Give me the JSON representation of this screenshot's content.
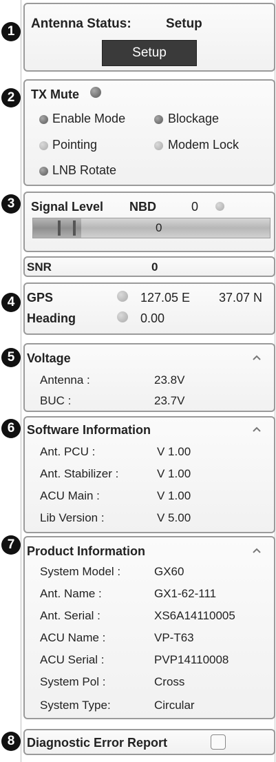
{
  "antenna_status": {
    "label": "Antenna Status:",
    "value": "Setup",
    "button_label": "Setup"
  },
  "tx_mute": {
    "title": "TX Mute",
    "indicators": [
      "Enable Mode",
      "Blockage",
      "Pointing",
      "Modem Lock",
      "LNB Rotate"
    ]
  },
  "signal": {
    "label": "Signal Level",
    "nbd_label": "NBD",
    "nbd_value": "0",
    "bar_value": "0"
  },
  "snr": {
    "label": "SNR",
    "value": "0"
  },
  "gps": {
    "label": "GPS",
    "longitude": "127.05 E",
    "latitude": "37.07 N",
    "heading_label": "Heading",
    "heading_value": "0.00"
  },
  "voltage": {
    "title": "Voltage",
    "rows": [
      {
        "label": "Antenna :",
        "value": "23.8V"
      },
      {
        "label": "BUC :",
        "value": "23.7V"
      }
    ]
  },
  "software": {
    "title": "Software Information",
    "rows": [
      {
        "label": "Ant. PCU :",
        "value": "V 1.00"
      },
      {
        "label": "Ant. Stabilizer :",
        "value": "V 1.00"
      },
      {
        "label": "ACU Main :",
        "value": "V 1.00"
      },
      {
        "label": "Lib Version :",
        "value": "V 5.00"
      }
    ]
  },
  "product": {
    "title": "Product Information",
    "rows": [
      {
        "label": "System Model :",
        "value": "GX60"
      },
      {
        "label": "Ant. Name :",
        "value": "GX1-62-111"
      },
      {
        "label": "Ant. Serial :",
        "value": "XS6A14110005"
      },
      {
        "label": "ACU Name :",
        "value": "VP-T63"
      },
      {
        "label": "ACU Serial :",
        "value": "PVP14110008"
      },
      {
        "label": "System Pol :",
        "value": "Cross"
      },
      {
        "label": "System Type:",
        "value": "Circular"
      }
    ]
  },
  "diagnostic": {
    "label": "Diagnostic Error Report"
  },
  "badges": [
    "1",
    "2",
    "3",
    "4",
    "5",
    "6",
    "7",
    "8"
  ],
  "icons": {
    "collapse": "chevron-up-icon",
    "status_led": "status-led-icon"
  },
  "colors": {
    "button_bg": "#3a3a3a",
    "led_dark": "#777777",
    "led_light": "#bdbdbd",
    "panel_border": "#9a9a9a"
  }
}
